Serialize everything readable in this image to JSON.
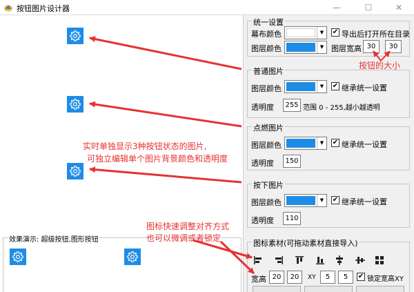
{
  "window": {
    "title": "按钮图片设计器",
    "min_glyph": "—",
    "max_glyph": "☐",
    "close_glyph": "✕"
  },
  "colors": {
    "accent": "#1e8ce6",
    "annotation": "#e63232",
    "swatch_white": "#ffffff"
  },
  "demo": {
    "legend": "效果演示: 超级按钮,图形按钮"
  },
  "unified": {
    "title": "统一设置",
    "curtain_color_label": "幕布颜色",
    "layer_color_label": "图层颜色",
    "export_open_label": "导出后打开所在目录",
    "layer_size_label": "图层宽高",
    "width": "30",
    "height": "30"
  },
  "normal": {
    "title": "普通图片",
    "layer_color_label": "图层颜色",
    "inherit_label": "继承统一设置",
    "opacity_label": "透明度",
    "opacity": "255",
    "range_hint": "范围 0 - 255,越小越透明"
  },
  "hover": {
    "title": "点燃图片",
    "layer_color_label": "图层颜色",
    "inherit_label": "继承统一设置",
    "opacity_label": "透明度",
    "opacity": "150"
  },
  "pressed": {
    "title": "按下图片",
    "layer_color_label": "图层颜色",
    "inherit_label": "继承统一设置",
    "opacity_label": "透明度",
    "opacity": "110"
  },
  "material": {
    "title": "图标素材(可拖动素材直接导入)",
    "size_label": "宽高",
    "width": "20",
    "height": "20",
    "xy_label": "XY",
    "x": "5",
    "y": "5",
    "lock_label": "锁定宽高XY"
  },
  "annotations": {
    "button_size": "按钮的大小",
    "realtime_line1": "实时单独显示3种按钮状态的图片,",
    "realtime_line2": "可独立编辑单个图片背景颜色和透明度",
    "align_line1": "图标快速调整对齐方式",
    "align_line2": "也可以微调或者锁定"
  },
  "icons": [
    "gear-icon",
    "app-icon",
    "checkmark-icon",
    "chevron-down-icon",
    "align-left-icon",
    "align-right-icon",
    "align-top-icon",
    "align-bottom-icon",
    "align-center-horizontal-icon",
    "align-center-vertical-icon",
    "grid-icon"
  ]
}
